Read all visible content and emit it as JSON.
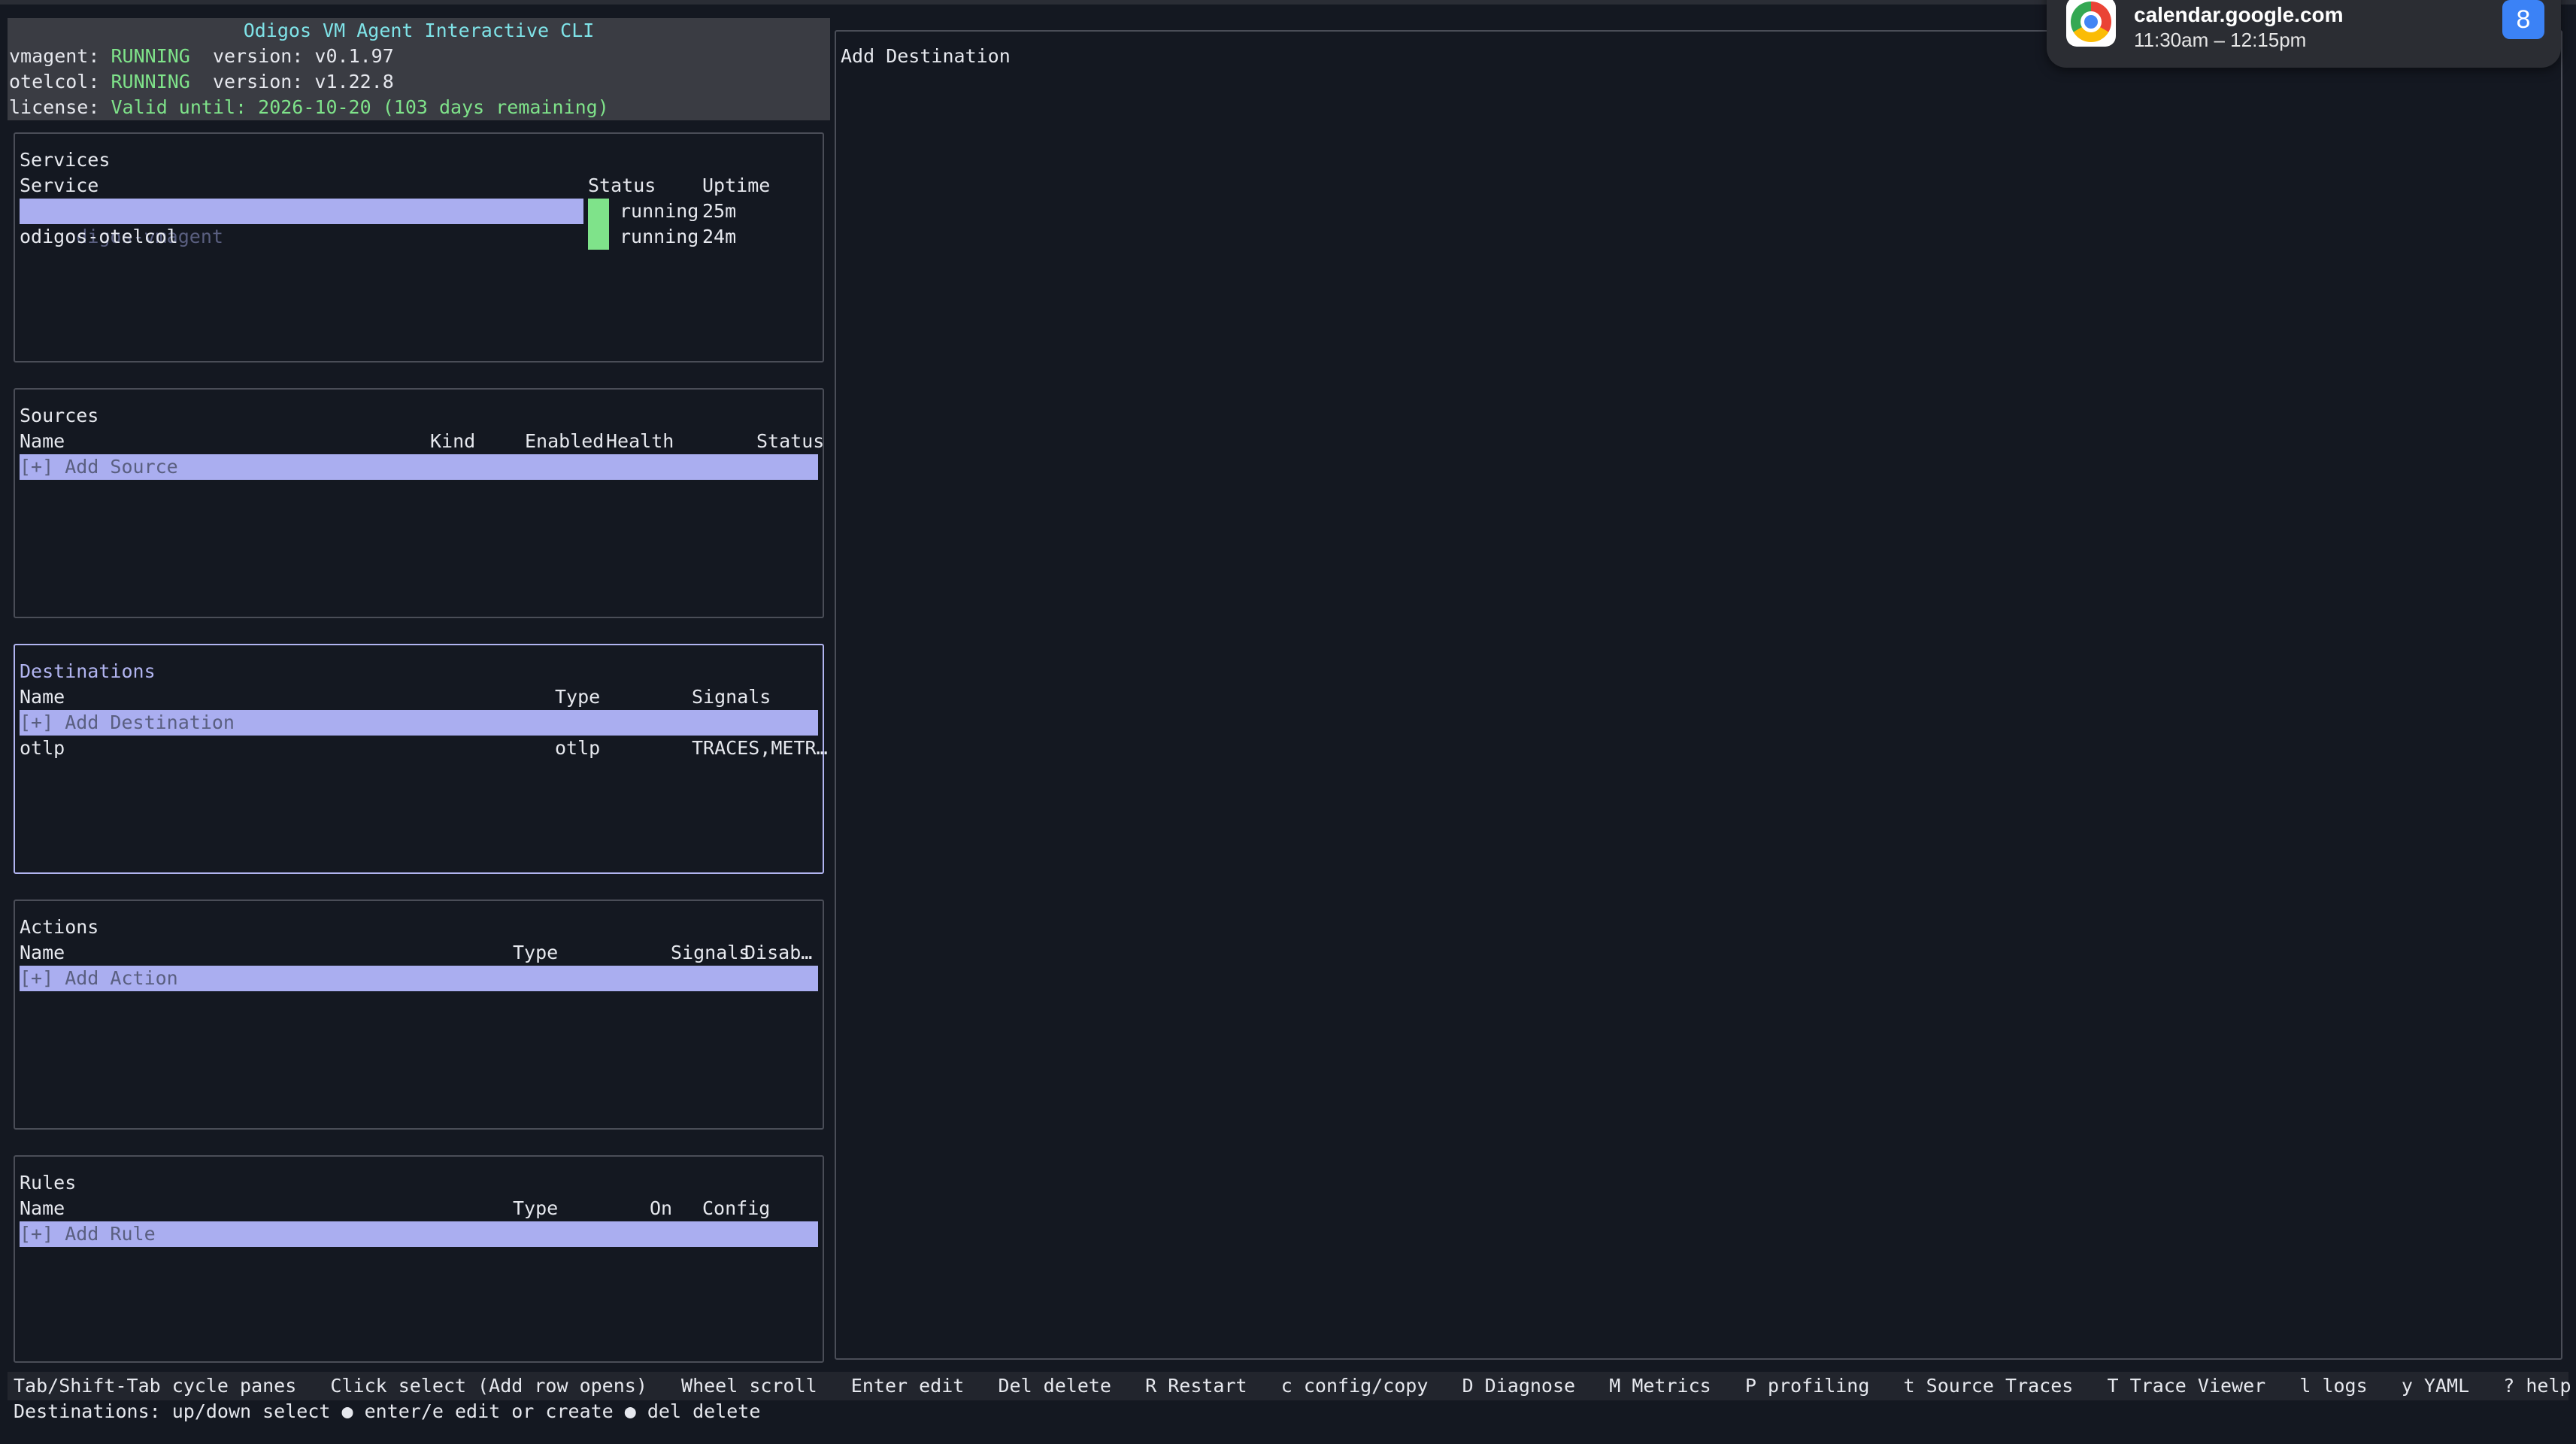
{
  "header": {
    "title": "Odigos VM Agent Interactive CLI",
    "vmagent_label": "vmagent:",
    "vmagent_status": "RUNNING",
    "vmagent_version": "version: v0.1.97",
    "otelcol_label": "otelcol:",
    "otelcol_status": "RUNNING",
    "otelcol_version": "version: v1.22.8",
    "license_label": "license:",
    "license_value": "Valid until: 2026-10-20 (103 days remaining)"
  },
  "services": {
    "title": "Services",
    "columns": [
      "Service",
      "Status",
      "Uptime"
    ],
    "rows": [
      {
        "name": "odigos-vmagent",
        "status": "running",
        "uptime": "25m"
      },
      {
        "name": "odigos-otelcol",
        "status": "running",
        "uptime": "24m"
      }
    ]
  },
  "sources": {
    "title": "Sources",
    "columns": [
      "Name",
      "Kind",
      "Enabled",
      "Health",
      "Status"
    ],
    "add_label": "[+] Add Source"
  },
  "destinations": {
    "title": "Destinations",
    "columns": [
      "Name",
      "Type",
      "Signals"
    ],
    "add_label": "[+] Add Destination",
    "rows": [
      {
        "name": "otlp",
        "type": "otlp",
        "signals": "TRACES,METR…"
      }
    ]
  },
  "actions": {
    "title": "Actions",
    "columns": [
      "Name",
      "Type",
      "Signals",
      "Disab…"
    ],
    "add_label": "[+] Add Action"
  },
  "rules": {
    "title": "Rules",
    "columns": [
      "Name",
      "Type",
      "On",
      "Config"
    ],
    "add_label": "[+] Add Rule"
  },
  "detail": {
    "title": "Add Destination"
  },
  "footer": {
    "keys": "Tab/Shift-Tab cycle panes   Click select (Add row opens)   Wheel scroll   Enter edit   Del delete   R Restart   c config/copy   D Diagnose   M Metrics   P profiling   t Source Traces   T Trace Viewer   l logs   y YAML   ? help",
    "hint": "Destinations: up/down select ● enter/e edit or create ● del delete"
  },
  "notification": {
    "app_icon": "chrome-icon",
    "site": "calendar.google.com",
    "time": "11:30am – 12:15pm",
    "calendar_badge": "8"
  },
  "colors": {
    "background": "#141821",
    "accent": "#b1b4f0",
    "selected_row": "#aaaef0",
    "running": "#7fe38a",
    "title": "#7fe3e8"
  }
}
